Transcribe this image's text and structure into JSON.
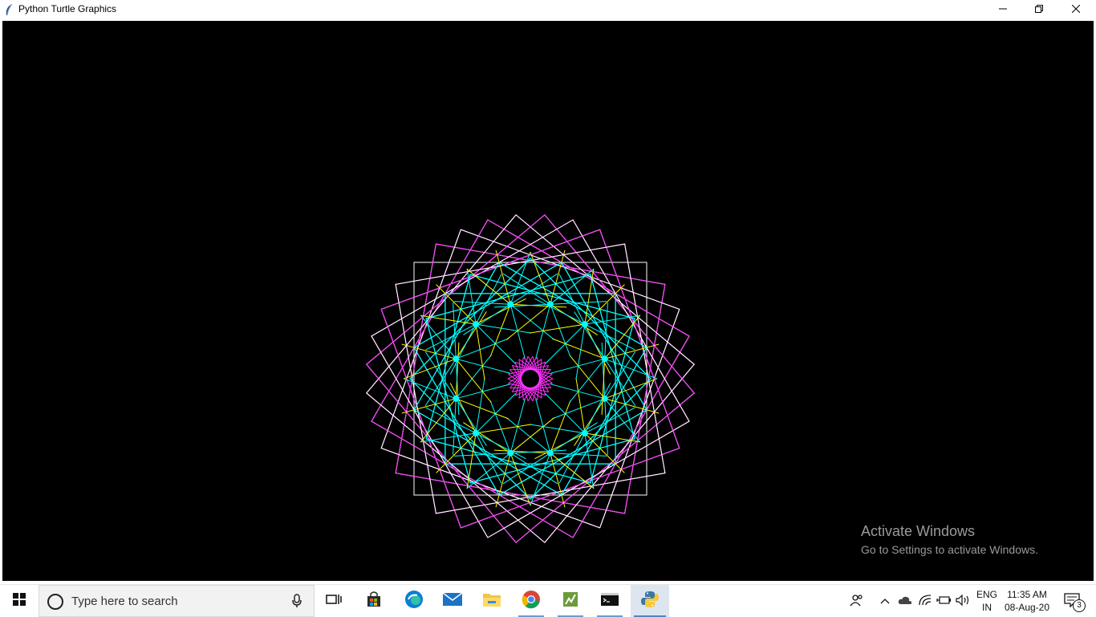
{
  "window": {
    "title": "Python Turtle Graphics",
    "icon": "feather-icon",
    "controls": [
      "minimize-icon",
      "restore-icon",
      "close-icon"
    ]
  },
  "canvas": {
    "background": "#000000",
    "colors": [
      "#ffffff",
      "#ff33ff",
      "#00ffff",
      "#ffff00"
    ],
    "watermark": {
      "line1": "Activate Windows",
      "line2": "Go to Settings to activate Windows."
    }
  },
  "taskbar": {
    "search_placeholder": "Type here to search",
    "pinned": [
      "task-view-icon",
      "microsoft-store-icon",
      "edge-icon",
      "mail-icon",
      "file-explorer-icon",
      "chrome-icon",
      "notepad-icon",
      "command-prompt-icon",
      "python-icon"
    ],
    "tray": {
      "lang_line1": "ENG",
      "lang_line2": "IN",
      "time": "11:35 AM",
      "date": "08-Aug-20",
      "notifications": "3"
    }
  }
}
